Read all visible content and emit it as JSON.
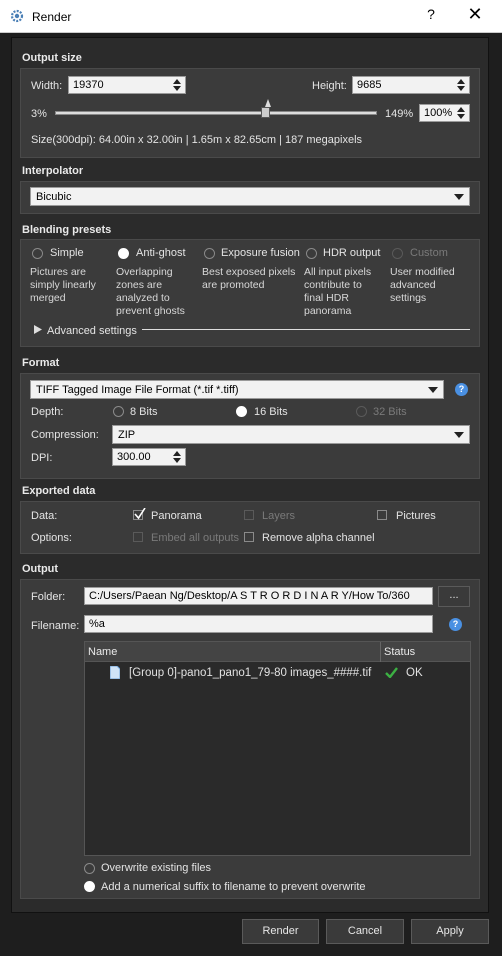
{
  "window": {
    "title": "Render",
    "help": "?",
    "close": "✕"
  },
  "output_size": {
    "section": "Output size",
    "width_label": "Width:",
    "width_value": "19370",
    "height_label": "Height:",
    "height_value": "9685",
    "min_label": "3%",
    "max_label": "149%",
    "zoom_value": "100%",
    "slider_level_percent": 100,
    "size_info": "Size(300dpi): 64.00in x 32.00in |  1.65m x 82.65cm | 187 megapixels"
  },
  "interpolator": {
    "section": "Interpolator",
    "value": "Bicubic"
  },
  "blending": {
    "section": "Blending presets",
    "options": [
      {
        "label": "Simple",
        "desc": [
          "Pictures are",
          "simply linearly",
          "merged"
        ],
        "selected": false,
        "enabled": true
      },
      {
        "label": "Anti-ghost",
        "desc": [
          "Overlapping",
          "zones are",
          "analyzed to",
          "prevent ghosts"
        ],
        "selected": true,
        "enabled": true
      },
      {
        "label": "Exposure fusion",
        "desc": [
          "Best exposed pixels",
          "are promoted"
        ],
        "selected": false,
        "enabled": true
      },
      {
        "label": "HDR output",
        "desc": [
          "All input pixels",
          "contribute to",
          "final HDR",
          "panorama"
        ],
        "selected": false,
        "enabled": true
      },
      {
        "label": "Custom",
        "desc": [
          "User modified",
          "advanced",
          "settings"
        ],
        "selected": false,
        "enabled": false
      }
    ],
    "advanced": "Advanced settings"
  },
  "format": {
    "section": "Format",
    "value": "TIFF Tagged Image File Format (*.tif *.tiff)",
    "depth_label": "Depth:",
    "depth_options": [
      "8 Bits",
      "16 Bits",
      "32 Bits"
    ],
    "depth_selected": "16 Bits",
    "compression_label": "Compression:",
    "compression_value": "ZIP",
    "dpi_label": "DPI:",
    "dpi_value": "300.00"
  },
  "exported": {
    "section": "Exported data",
    "data_label": "Data:",
    "panorama": "Panorama",
    "layers": "Layers",
    "pictures": "Pictures",
    "options_label": "Options:",
    "embed": "Embed all outputs",
    "remove_alpha": "Remove alpha channel"
  },
  "output": {
    "section": "Output",
    "folder_label": "Folder:",
    "folder_value": "C:/Users/Paean Ng/Desktop/A S T R O R D I N A R Y/How To/360",
    "browse": "...",
    "filename_label": "Filename:",
    "filename_value": "%a",
    "col_name": "Name",
    "col_status": "Status",
    "files": [
      {
        "name": "[Group 0]-pano1_pano1_79-80 images_####.tif",
        "status": "OK"
      }
    ],
    "overwrite": "Overwrite existing files",
    "suffix": "Add a numerical suffix to filename to prevent overwrite"
  },
  "buttons": {
    "render": "Render",
    "cancel": "Cancel",
    "apply": "Apply"
  },
  "colors": {
    "accent_help": "#4a90e2",
    "ok_green": "#3cb043",
    "background": "#2b2b2b",
    "group": "#3b3b3b"
  },
  "icons": {
    "window": "gear-icon",
    "file": "document-icon",
    "status": "checkmark-icon"
  }
}
